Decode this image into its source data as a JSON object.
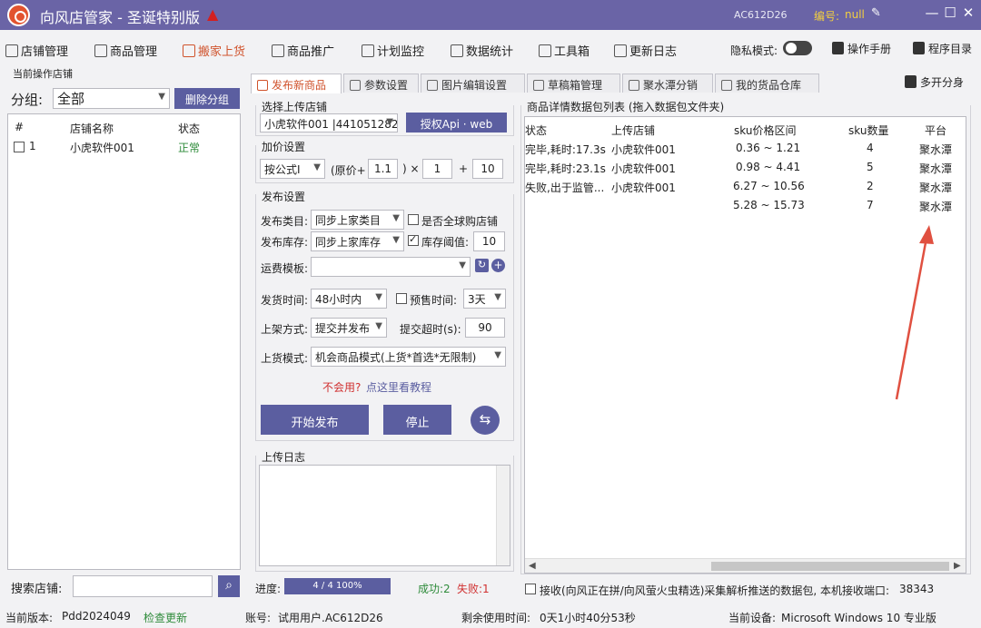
{
  "titlebar": {
    "title": "向风店管家 - 圣诞特别版",
    "hat_icon": "santa-hat-icon",
    "machine_code": "AC612D26",
    "number_label": "编号:",
    "number_value": "null",
    "minimize": "—",
    "maximize": "☐",
    "close": "✕"
  },
  "menu": {
    "items": [
      "店铺管理",
      "商品管理",
      "搬家上货",
      "商品推广",
      "计划监控",
      "数据统计",
      "工具箱",
      "更新日志"
    ],
    "active_index": 2,
    "privacy_label": "隐私模式:",
    "manual_label": "操作手册",
    "program_dir_label": "程序目录",
    "multi_open_label": "多开分身"
  },
  "left_panel": {
    "section_title": "当前操作店铺",
    "group_label": "分组:",
    "group_value": "全部",
    "delete_group_button": "删除分组",
    "columns": [
      "#",
      "店铺名称",
      "状态"
    ],
    "rows": [
      {
        "index": "1",
        "name": "小虎软件001",
        "status": "正常"
      }
    ],
    "search_label": "搜索店铺:",
    "search_value": "",
    "status_color": "#2e8b3a"
  },
  "tabs": [
    "发布新商品",
    "参数设置",
    "图片编辑设置",
    "草稿箱管理",
    "聚水潭分销",
    "我的货品仓库"
  ],
  "active_tab": 0,
  "store_section": {
    "title": "选择上传店铺",
    "store_value": "小虎软件001 |441051282",
    "auth_button": "授权Api · web"
  },
  "price_section": {
    "title": "加价设置",
    "formula_value": "按公式I",
    "text_open": "(原价+",
    "add_value": "1.1",
    "text_times": ") ×",
    "mult_value": "1",
    "text_plus": "+",
    "plus_value": "10"
  },
  "publish_section": {
    "title": "发布设置",
    "category_label": "发布类目:",
    "category_value": "同步上家类目",
    "global_store_label": "是否全球购店铺",
    "global_store_checked": false,
    "stock_label": "发布库存:",
    "stock_value": "同步上家库存",
    "stock_threshold_label": "库存阈值:",
    "stock_threshold_checked": true,
    "stock_threshold_value": "10",
    "freight_label": "运费模板:",
    "freight_value": "",
    "ship_time_label": "发货时间:",
    "ship_time_value": "48小时内",
    "presale_label": "预售时间:",
    "presale_checked": false,
    "presale_value": "3天",
    "listing_label": "上架方式:",
    "listing_value": "提交并发布",
    "timeout_label": "提交超时(s):",
    "timeout_value": "90",
    "mode_label": "上货模式:",
    "mode_value": "机会商品模式(上货*首选*无限制)",
    "help_text": "不会用?",
    "help_link": "点这里看教程",
    "start_button": "开始发布",
    "stop_button": "停止"
  },
  "log_section": {
    "title": "上传日志",
    "content": ""
  },
  "progress": {
    "label": "进度:",
    "text": "4 / 4   100%",
    "fraction": 1.0,
    "success_text": "成功:2",
    "fail_text": "失败:1"
  },
  "data_list": {
    "title": "商品详情数据包列表 (拖入数据包文件夹)",
    "columns": [
      "状态",
      "上传店铺",
      "sku价格区间",
      "sku数量",
      "平台"
    ],
    "rows": [
      {
        "status": "完毕,耗时:17.3s",
        "store": "小虎软件001",
        "range": "0.36 ~ 1.21",
        "count": "4",
        "platform": "聚水潭"
      },
      {
        "status": "完毕,耗时:23.1s",
        "store": "小虎软件001",
        "range": "0.98 ~ 4.41",
        "count": "5",
        "platform": "聚水潭"
      },
      {
        "status": "失败,出于监管...",
        "store": "小虎软件001",
        "range": "6.27 ~ 10.56",
        "count": "2",
        "platform": "聚水潭"
      },
      {
        "status": "",
        "store": "",
        "range": "5.28 ~ 15.73",
        "count": "7",
        "platform": "聚水潭"
      }
    ],
    "receive_label": "接收(向风正在拼/向风萤火虫精选)采集解析推送的数据包, 本机接收端口:",
    "receive_port": "38343"
  },
  "statusbar": {
    "version_label": "当前版本:",
    "version_value": "Pdd2024049",
    "check_update": "检查更新",
    "account_label": "账号:",
    "account_value": "试用用户.AC612D26",
    "remain_label": "剩余使用时间:",
    "remain_value": "0天1小时40分53秒",
    "device_label": "当前设备:",
    "device_value": "Microsoft Windows 10 专业版"
  },
  "colors": {
    "title_bar": "#6a64a6",
    "button": "#5b5ea0",
    "accent": "#d0532c",
    "success": "#2e8b3a",
    "fail": "#d03030",
    "annotation_arrow": "#e05040"
  }
}
